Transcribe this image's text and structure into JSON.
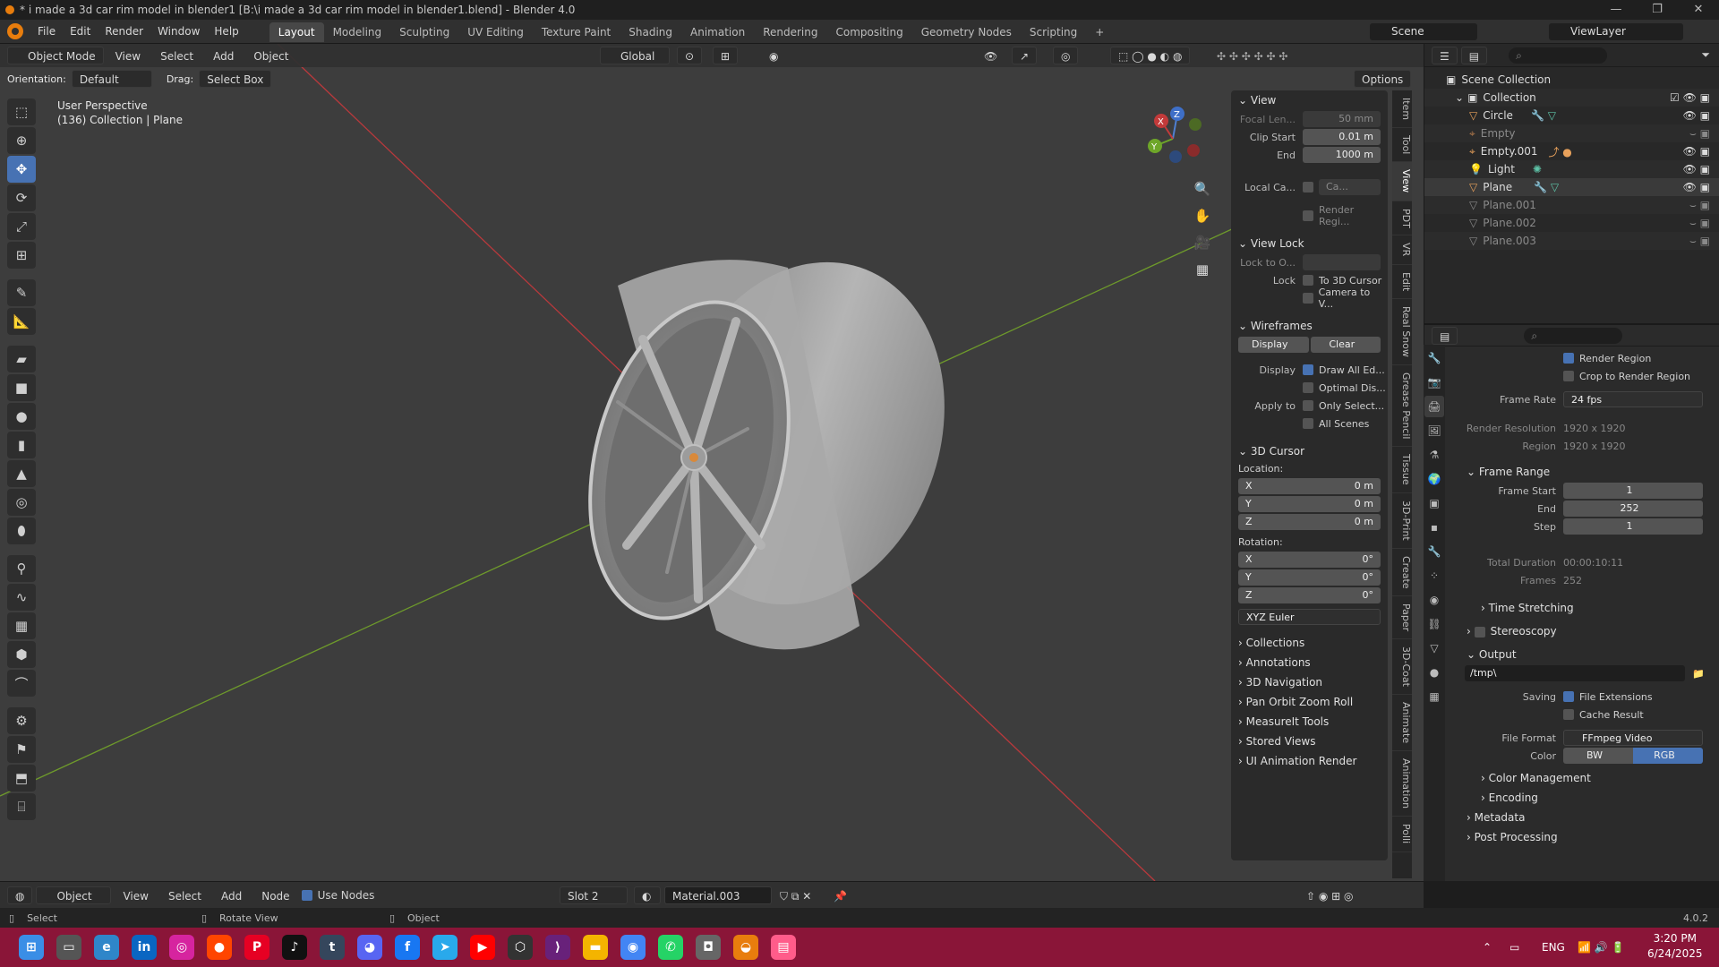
{
  "window": {
    "title": "* i made a 3d car rim model in blender1 [B:\\i made a 3d car rim model in blender1.blend] - Blender 4.0",
    "buttons": [
      "—",
      "❐",
      "✕"
    ]
  },
  "menu": [
    "File",
    "Edit",
    "Render",
    "Window",
    "Help"
  ],
  "workspaces": [
    "Layout",
    "Modeling",
    "Sculpting",
    "UV Editing",
    "Texture Paint",
    "Shading",
    "Animation",
    "Rendering",
    "Compositing",
    "Geometry Nodes",
    "Scripting",
    "+"
  ],
  "active_workspace": "Layout",
  "scene": {
    "label": "Scene",
    "viewlayer": "ViewLayer"
  },
  "viewport_header": {
    "mode": "Object Mode",
    "items": [
      "View",
      "Select",
      "Add",
      "Object"
    ],
    "transform": "Global",
    "orientation_label": "Orientation:",
    "orientation_value": "Default",
    "drag_label": "Drag:",
    "drag_value": "Select Box",
    "options": "Options"
  },
  "viewport_info": {
    "line1": "User Perspective",
    "line2": "(136) Collection | Plane"
  },
  "gizmo": {
    "x": "X",
    "y": "Y",
    "z": "Z"
  },
  "npanel": {
    "view_title": "View",
    "focal_label": "Focal Len...",
    "focal_value": "50 mm",
    "clip_start_label": "Clip Start",
    "clip_start_value": "0.01 m",
    "clip_end_label": "End",
    "clip_end_value": "1000 m",
    "local_cam_label": "Local Ca...",
    "local_cam_value": "Ca...",
    "render_region": "Render Regi...",
    "view_lock_title": "View Lock",
    "lock_to_obj_label": "Lock to O...",
    "lock_label": "Lock",
    "lock_cursor": "To 3D Cursor",
    "lock_camera": "Camera to V...",
    "wireframes_title": "Wireframes",
    "wf_display": "Display",
    "wf_clear": "Clear",
    "display_label": "Display",
    "draw_all_edges": "Draw All Ed...",
    "optimal_display": "Optimal Dis...",
    "apply_to_label": "Apply to",
    "only_selected": "Only Select...",
    "all_scenes": "All Scenes",
    "cursor_title": "3D Cursor",
    "location_label": "Location:",
    "loc": [
      {
        "axis": "X",
        "value": "0 m"
      },
      {
        "axis": "Y",
        "value": "0 m"
      },
      {
        "axis": "Z",
        "value": "0 m"
      }
    ],
    "rotation_label": "Rotation:",
    "rot": [
      {
        "axis": "X",
        "value": "0°"
      },
      {
        "axis": "Y",
        "value": "0°"
      },
      {
        "axis": "Z",
        "value": "0°"
      }
    ],
    "rot_mode": "XYZ Euler",
    "collapsed": [
      "Collections",
      "Annotations",
      "3D Navigation",
      "Pan Orbit Zoom Roll",
      "MeasureIt Tools",
      "Stored Views",
      "UI Animation Render"
    ]
  },
  "ntabs": [
    "Item",
    "Tool",
    "View",
    "PDT",
    "VR",
    "Edit",
    "Real Snow",
    "Grease Pencil",
    "Tissue",
    "3D-Print",
    "Create",
    "Paper",
    "3D-Coat",
    "Animate",
    "Animation",
    "Polli"
  ],
  "ntab_active": "View",
  "outliner": {
    "title": "Scene Collection",
    "collection": "Collection",
    "items": [
      {
        "name": "Circle",
        "dim": false
      },
      {
        "name": "Empty",
        "dim": true
      },
      {
        "name": "Empty.001",
        "dim": false
      },
      {
        "name": "Light",
        "dim": false
      },
      {
        "name": "Plane",
        "dim": false
      },
      {
        "name": "Plane.001",
        "dim": true
      },
      {
        "name": "Plane.002",
        "dim": true
      },
      {
        "name": "Plane.003",
        "dim": true
      }
    ]
  },
  "properties": {
    "render_region": "Render Region",
    "crop_region": "Crop to Render Region",
    "frame_rate_label": "Frame Rate",
    "frame_rate_value": "24 fps",
    "res_label": "Render Resolution",
    "res_value": "1920 x 1920",
    "region_label": "Region",
    "region_value": "1920 x 1920",
    "frame_range_title": "Frame Range",
    "frame_start_label": "Frame Start",
    "frame_start_value": "1",
    "end_label": "End",
    "end_value": "252",
    "step_label": "Step",
    "step_value": "1",
    "duration_label": "Total Duration",
    "duration_value": "00:00:10:11",
    "frames_label": "Frames",
    "frames_value": "252",
    "time_stretching": "Time Stretching",
    "stereoscopy": "Stereoscopy",
    "output_title": "Output",
    "output_path": "/tmp\\",
    "saving_label": "Saving",
    "file_ext": "File Extensions",
    "cache_result": "Cache Result",
    "file_format_label": "File Format",
    "file_format_value": "FFmpeg Video",
    "color_label": "Color",
    "color_bw": "BW",
    "color_rgb": "RGB",
    "color_mgmt": "Color Management",
    "encoding": "Encoding",
    "metadata": "Metadata",
    "post_processing": "Post Processing"
  },
  "bottom": {
    "editor": "Object",
    "items": [
      "View",
      "Select",
      "Add",
      "Node"
    ],
    "use_nodes": "Use Nodes",
    "slot": "Slot 2",
    "material": "Material.003"
  },
  "status": {
    "select": "Select",
    "rotate": "Rotate View",
    "object": "Object",
    "version": "4.0.2"
  },
  "taskbar": {
    "lang": "ENG",
    "time": "3:20 PM",
    "date": "6/24/2025"
  },
  "colors": {
    "accent": "#4772b3",
    "axis_x": "#c23a3a",
    "axis_y": "#6ea629",
    "taskbar": "#8a1538"
  }
}
